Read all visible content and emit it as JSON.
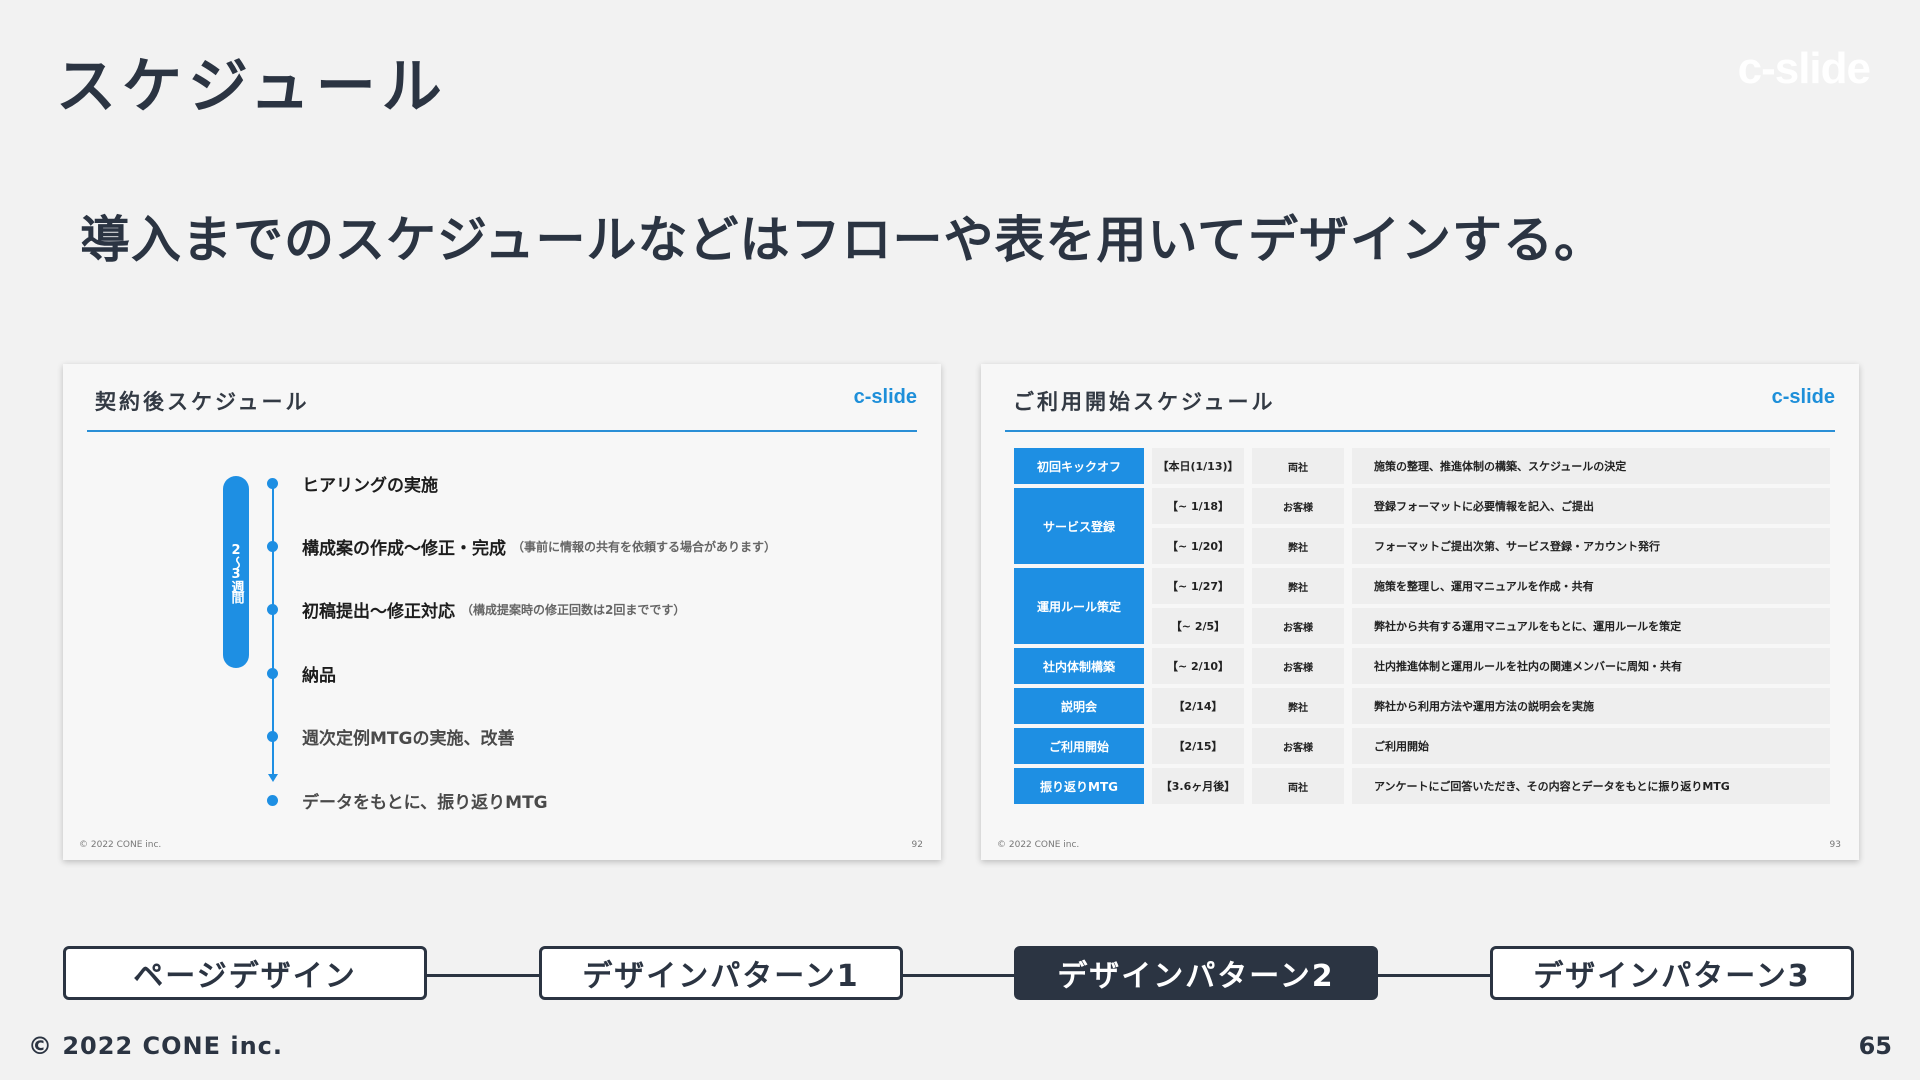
{
  "header": {
    "title": "スケジュール",
    "logo": "c-slide"
  },
  "headline": "導入までのスケジュールなどはフローや表を用いてデザインする。",
  "slide_left": {
    "title": "契約後スケジュール",
    "logo": "c-slide",
    "week_label": "2〜3週間",
    "items": [
      {
        "text": "ヒアリングの実施",
        "note": ""
      },
      {
        "text": "構成案の作成〜修正・完成",
        "note": "（事前に情報の共有を依頼する場合があります）"
      },
      {
        "text": "初稿提出〜修正対応",
        "note": "（構成提案時の修正回数は2回までです）"
      },
      {
        "text": "納品",
        "note": ""
      },
      {
        "text": "週次定例MTGの実施、改善",
        "note": ""
      },
      {
        "text": "データをもとに、振り返りMTG",
        "note": ""
      }
    ],
    "copyright": "© 2022 CONE inc.",
    "page": "92"
  },
  "slide_right": {
    "title": "ご利用開始スケジュール",
    "logo": "c-slide",
    "groups": [
      {
        "phase": "初回キックオフ",
        "rows": [
          {
            "date": "【本日(1/13)】",
            "party": "両社",
            "desc": "施策の整理、推進体制の構築、スケジュールの決定"
          }
        ]
      },
      {
        "phase": "サービス登録",
        "rows": [
          {
            "date": "【~ 1/18】",
            "party": "お客様",
            "desc": "登録フォーマットに必要情報を記入、ご提出"
          },
          {
            "date": "【~ 1/20】",
            "party": "弊社",
            "desc": "フォーマットご提出次第、サービス登録・アカウント発行"
          }
        ]
      },
      {
        "phase": "運用ルール策定",
        "rows": [
          {
            "date": "【~ 1/27】",
            "party": "弊社",
            "desc": "施策を整理し、運用マニュアルを作成・共有"
          },
          {
            "date": "【~ 2/5】",
            "party": "お客様",
            "desc": "弊社から共有する運用マニュアルをもとに、運用ルールを策定"
          }
        ]
      },
      {
        "phase": "社内体制構築",
        "rows": [
          {
            "date": "【~ 2/10】",
            "party": "お客様",
            "desc": "社内推進体制と運用ルールを社内の関連メンバーに周知・共有"
          }
        ]
      },
      {
        "phase": "説明会",
        "rows": [
          {
            "date": "【2/14】",
            "party": "弊社",
            "desc": "弊社から利用方法や運用方法の説明会を実施"
          }
        ]
      },
      {
        "phase": "ご利用開始",
        "rows": [
          {
            "date": "【2/15】",
            "party": "お客様",
            "desc": "ご利用開始"
          }
        ]
      },
      {
        "phase": "振り返りMTG",
        "rows": [
          {
            "date": "【3.6ヶ月後】",
            "party": "両社",
            "desc": "アンケートにご回答いただき、その内容とデータをもとに振り返りMTG"
          }
        ]
      }
    ],
    "copyright": "© 2022 CONE inc.",
    "page": "93"
  },
  "nav": {
    "items": [
      "ページデザイン",
      "デザインパターン1",
      "デザインパターン2",
      "デザインパターン3"
    ],
    "active_index": 2
  },
  "footer": {
    "copyright": "© 2022 CONE inc.",
    "page": "65"
  },
  "colors": {
    "primary": "#2b3442",
    "accent": "#1e8fe3",
    "background": "#f2f2f2"
  }
}
